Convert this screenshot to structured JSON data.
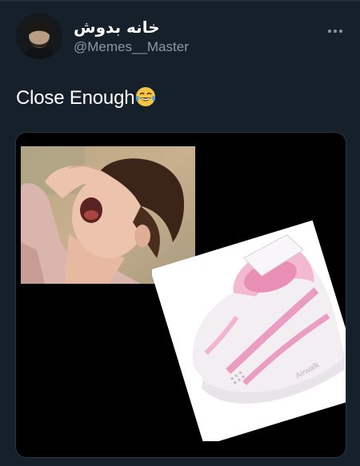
{
  "tweet": {
    "display_name": "خانه بدوش",
    "handle": "@Memes__Master",
    "text": "Close Enough",
    "emoji": "face-with-tears-of-joy-icon",
    "more_icon": "more-dots-icon"
  },
  "media": {
    "images": [
      {
        "name": "boy-yawning-photo"
      },
      {
        "name": "pink-sneaker-photo",
        "visible_text": "Airwalk"
      }
    ]
  },
  "colors": {
    "background": "#15202b",
    "text": "#ffffff",
    "secondary": "#8899a6",
    "media_background": "#000000"
  }
}
